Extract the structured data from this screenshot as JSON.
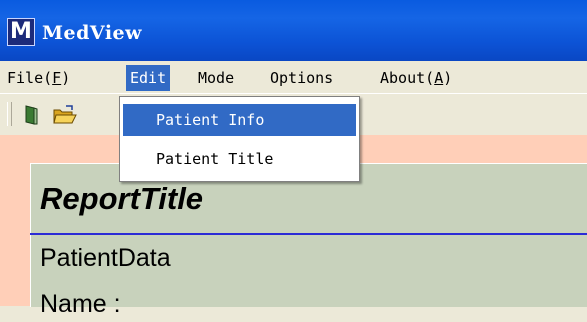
{
  "window": {
    "title": "MedView",
    "icon_letter": "M",
    "title_bar_color": "#0a5be0"
  },
  "menubar": {
    "items": [
      {
        "label": "File(",
        "mnemonic": "F",
        "suffix": ")"
      },
      {
        "label": "Edit"
      },
      {
        "label": "Mode"
      },
      {
        "label": "Options"
      },
      {
        "label": "About(",
        "mnemonic": "A",
        "suffix": ")"
      }
    ],
    "active_item": "Edit"
  },
  "toolbar": {
    "icons": [
      "new-document-icon",
      "open-folder-icon"
    ]
  },
  "edit_menu": {
    "items": [
      {
        "label": "Patient Info",
        "highlighted": true
      },
      {
        "label": "Patient Title",
        "highlighted": false
      }
    ],
    "highlight_color": "#316ac5"
  },
  "report": {
    "title": "ReportTitle",
    "section": "PatientData",
    "name_label": "Name :",
    "panel_color": "#c8d2bc",
    "background_color": "#ffcfb8",
    "divider_color": "#2b2bd6"
  }
}
